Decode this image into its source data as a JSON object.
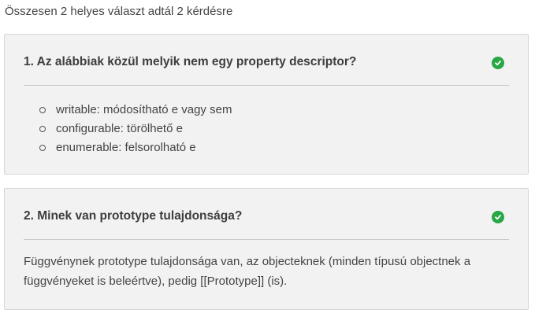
{
  "summary": "Összesen 2 helyes választ adtál 2 kérdésre",
  "questions": [
    {
      "title": "1. Az alábbiak közül melyik nem egy property descriptor?",
      "status_icon": "check-circle-icon",
      "status_color": "#28a745",
      "options": [
        "writable: módosítható e vagy sem",
        "configurable: törölhető e",
        "enumerable: felsorolható e"
      ]
    },
    {
      "title": "2. Minek van prototype tulajdonsága?",
      "status_icon": "check-circle-icon",
      "status_color": "#28a745",
      "answer": "Függvénynek prototype tulajdonsága van, az objecteknek (minden típusú objectnek a függvényeket is beleértve), pedig [[Prototype]] (is)."
    }
  ]
}
